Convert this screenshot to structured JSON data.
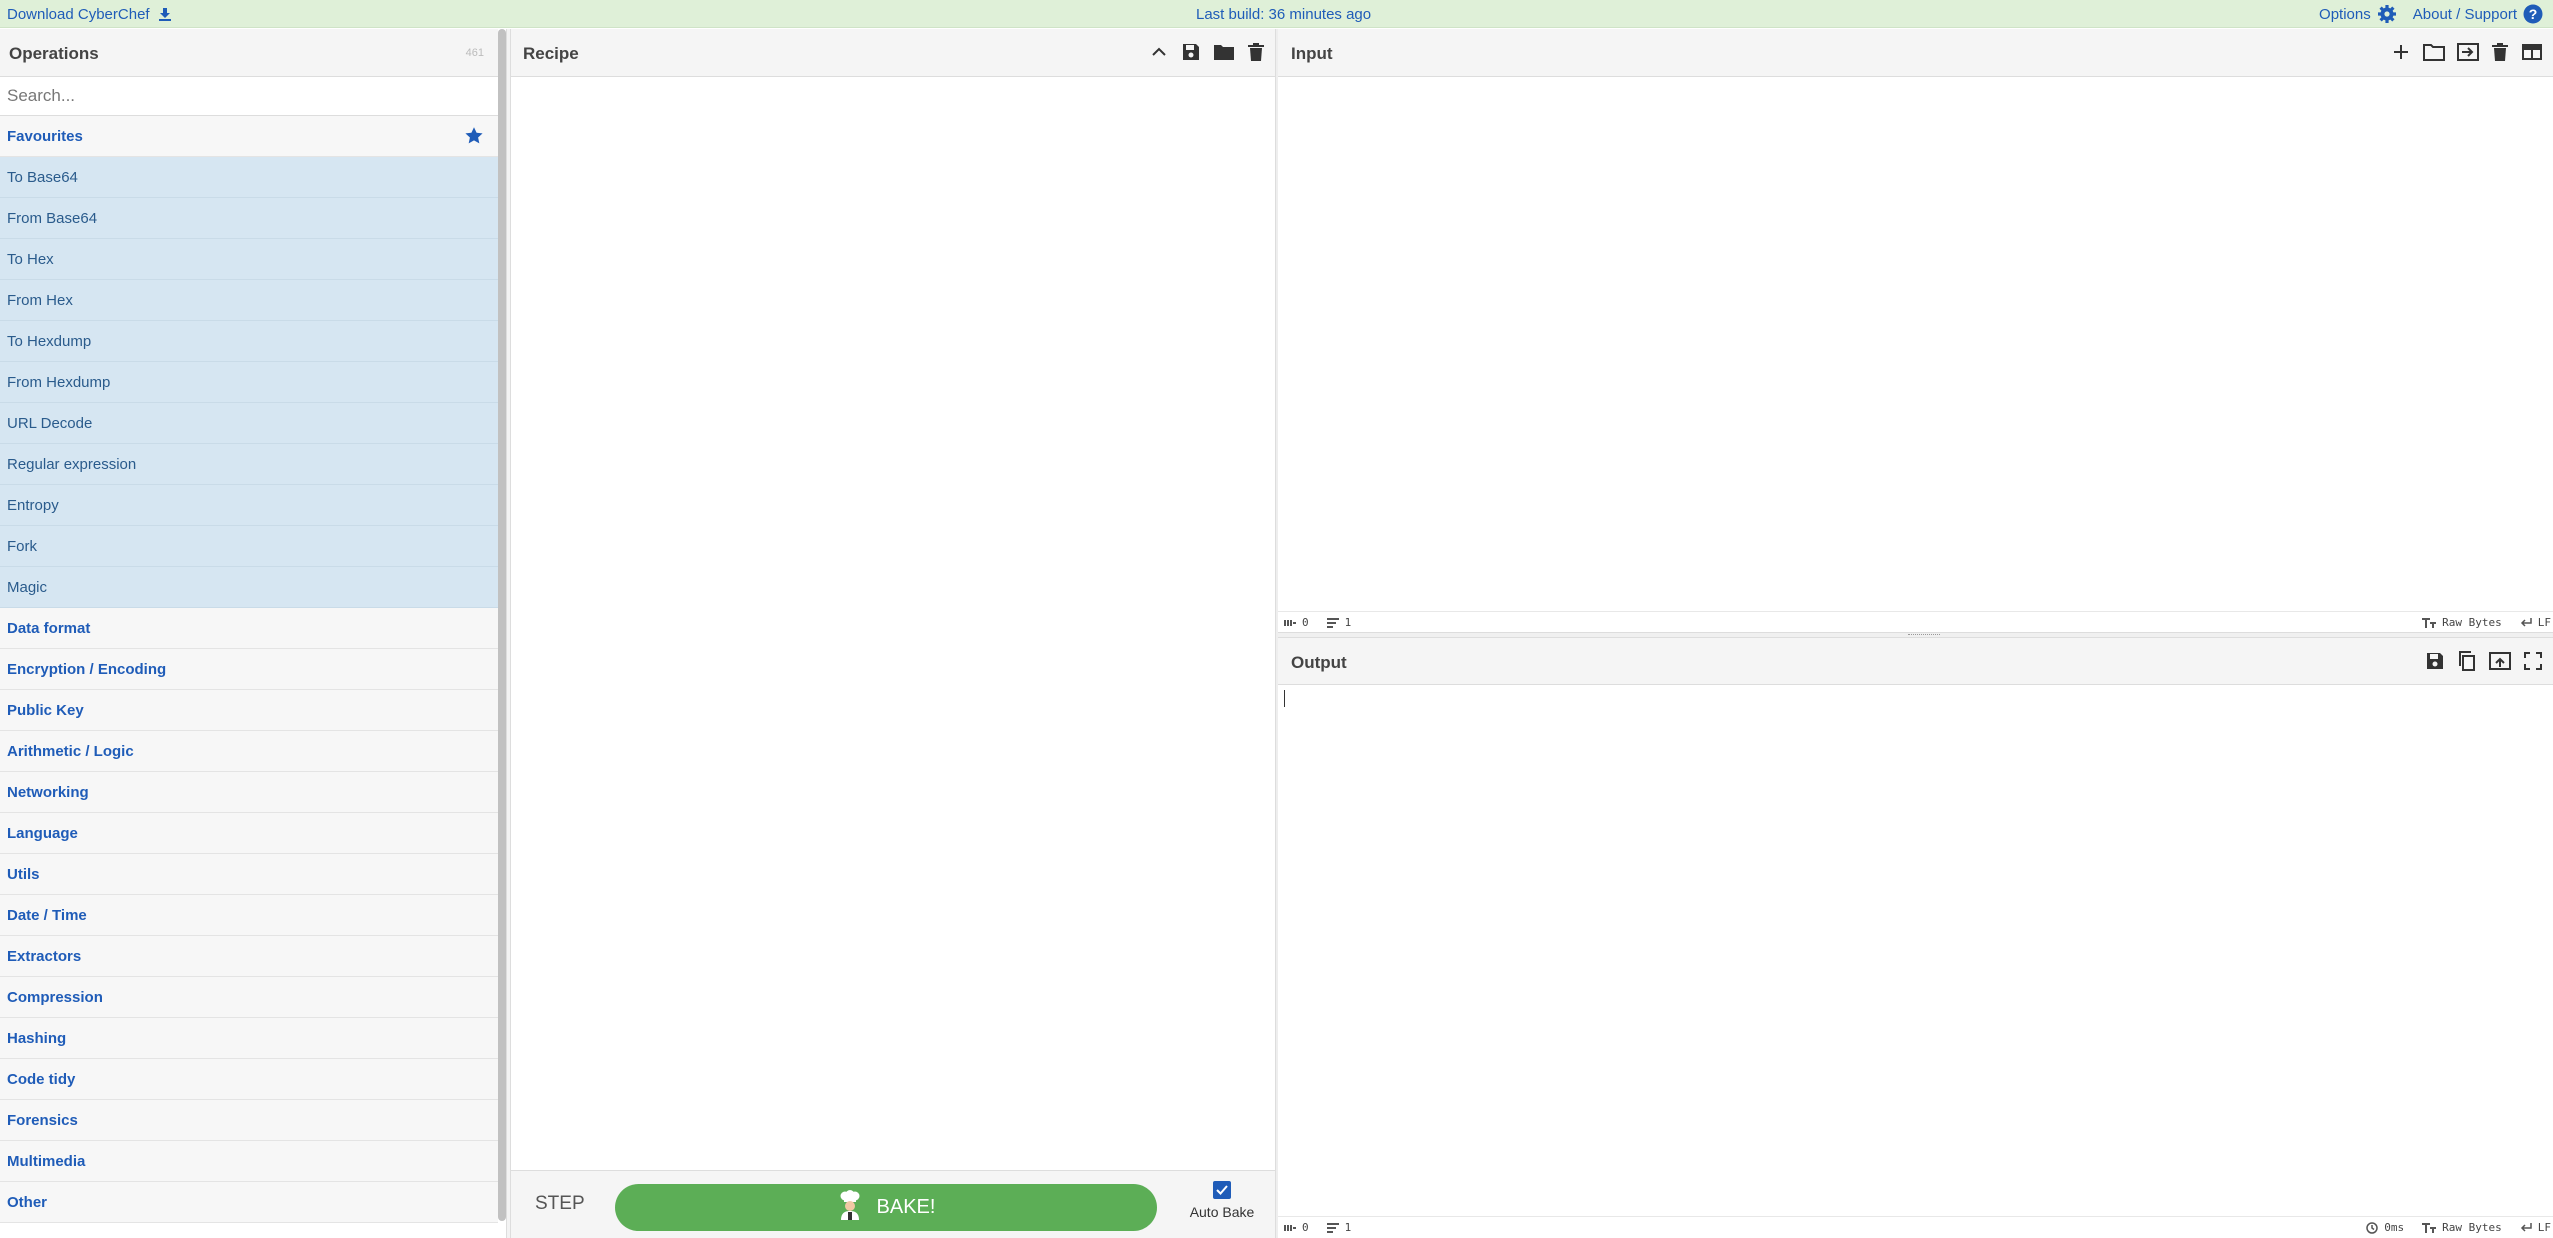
{
  "banner": {
    "download_label": "Download CyberChef",
    "last_build": "Last build: 36 minutes ago",
    "options_label": "Options",
    "about_label": "About / Support"
  },
  "operations": {
    "title": "Operations",
    "count": "461",
    "search_placeholder": "Search...",
    "favourites_label": "Favourites",
    "favourites": [
      "To Base64",
      "From Base64",
      "To Hex",
      "From Hex",
      "To Hexdump",
      "From Hexdump",
      "URL Decode",
      "Regular expression",
      "Entropy",
      "Fork",
      "Magic"
    ],
    "categories": [
      "Data format",
      "Encryption / Encoding",
      "Public Key",
      "Arithmetic / Logic",
      "Networking",
      "Language",
      "Utils",
      "Date / Time",
      "Extractors",
      "Compression",
      "Hashing",
      "Code tidy",
      "Forensics",
      "Multimedia",
      "Other"
    ]
  },
  "recipe": {
    "title": "Recipe",
    "step_label": "STEP",
    "bake_label": "BAKE!",
    "autobake_label": "Auto Bake",
    "autobake_checked": true
  },
  "input": {
    "title": "Input",
    "char_count": "0",
    "line_count": "1",
    "encoding": "Raw Bytes",
    "eol": "LF"
  },
  "output": {
    "title": "Output",
    "time": "0ms",
    "char_count": "0",
    "line_count": "1",
    "encoding": "Raw Bytes",
    "eol": "LF"
  },
  "colors": {
    "banner_bg": "#dff0d8",
    "link": "#1f5cb8",
    "favourite_bg": "#d6e6f2",
    "bake_green": "#5cae56"
  }
}
